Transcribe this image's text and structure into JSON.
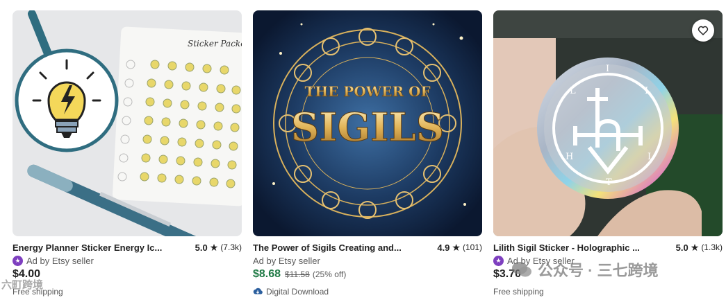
{
  "listings": [
    {
      "title": "Energy Planner Sticker Energy Ic...",
      "rating": "5.0",
      "review_count": "(7.3k)",
      "ad_label": "Ad by Etsy seller",
      "price": "$4.00",
      "shipping": "Free shipping",
      "image_text": "Sticker Packed",
      "star_seller": true
    },
    {
      "title": "The Power of Sigils Creating and...",
      "rating": "4.9",
      "review_count": "(101)",
      "ad_label": "Ad by Etsy seller",
      "price": "$8.68",
      "original_price": "$11.58",
      "discount": "(25% off)",
      "shipping": "Digital Download",
      "image_text_line1": "THE POWER OF",
      "image_text_line2": "SIGILS",
      "star_seller": false
    },
    {
      "title": "Lilith Sigil Sticker - Holographic ...",
      "rating": "5.0",
      "review_count": "(1.3k)",
      "ad_label": "Ad by Etsy seller",
      "price": "$3.70",
      "shipping": "Free shipping",
      "image_text_letters": [
        "L",
        "I",
        "L",
        "I",
        "T",
        "H"
      ],
      "star_seller": true
    }
  ],
  "watermark": {
    "right": "公众号 · 三七跨境",
    "left": "六町跨境"
  },
  "colors": {
    "sale_price": "#1f7a45",
    "star_seller": "#7e3fbf",
    "text_primary": "#222222",
    "text_secondary": "#595959"
  },
  "icons": [
    "heart-icon",
    "star-icon",
    "star-seller-icon",
    "download-icon"
  ]
}
